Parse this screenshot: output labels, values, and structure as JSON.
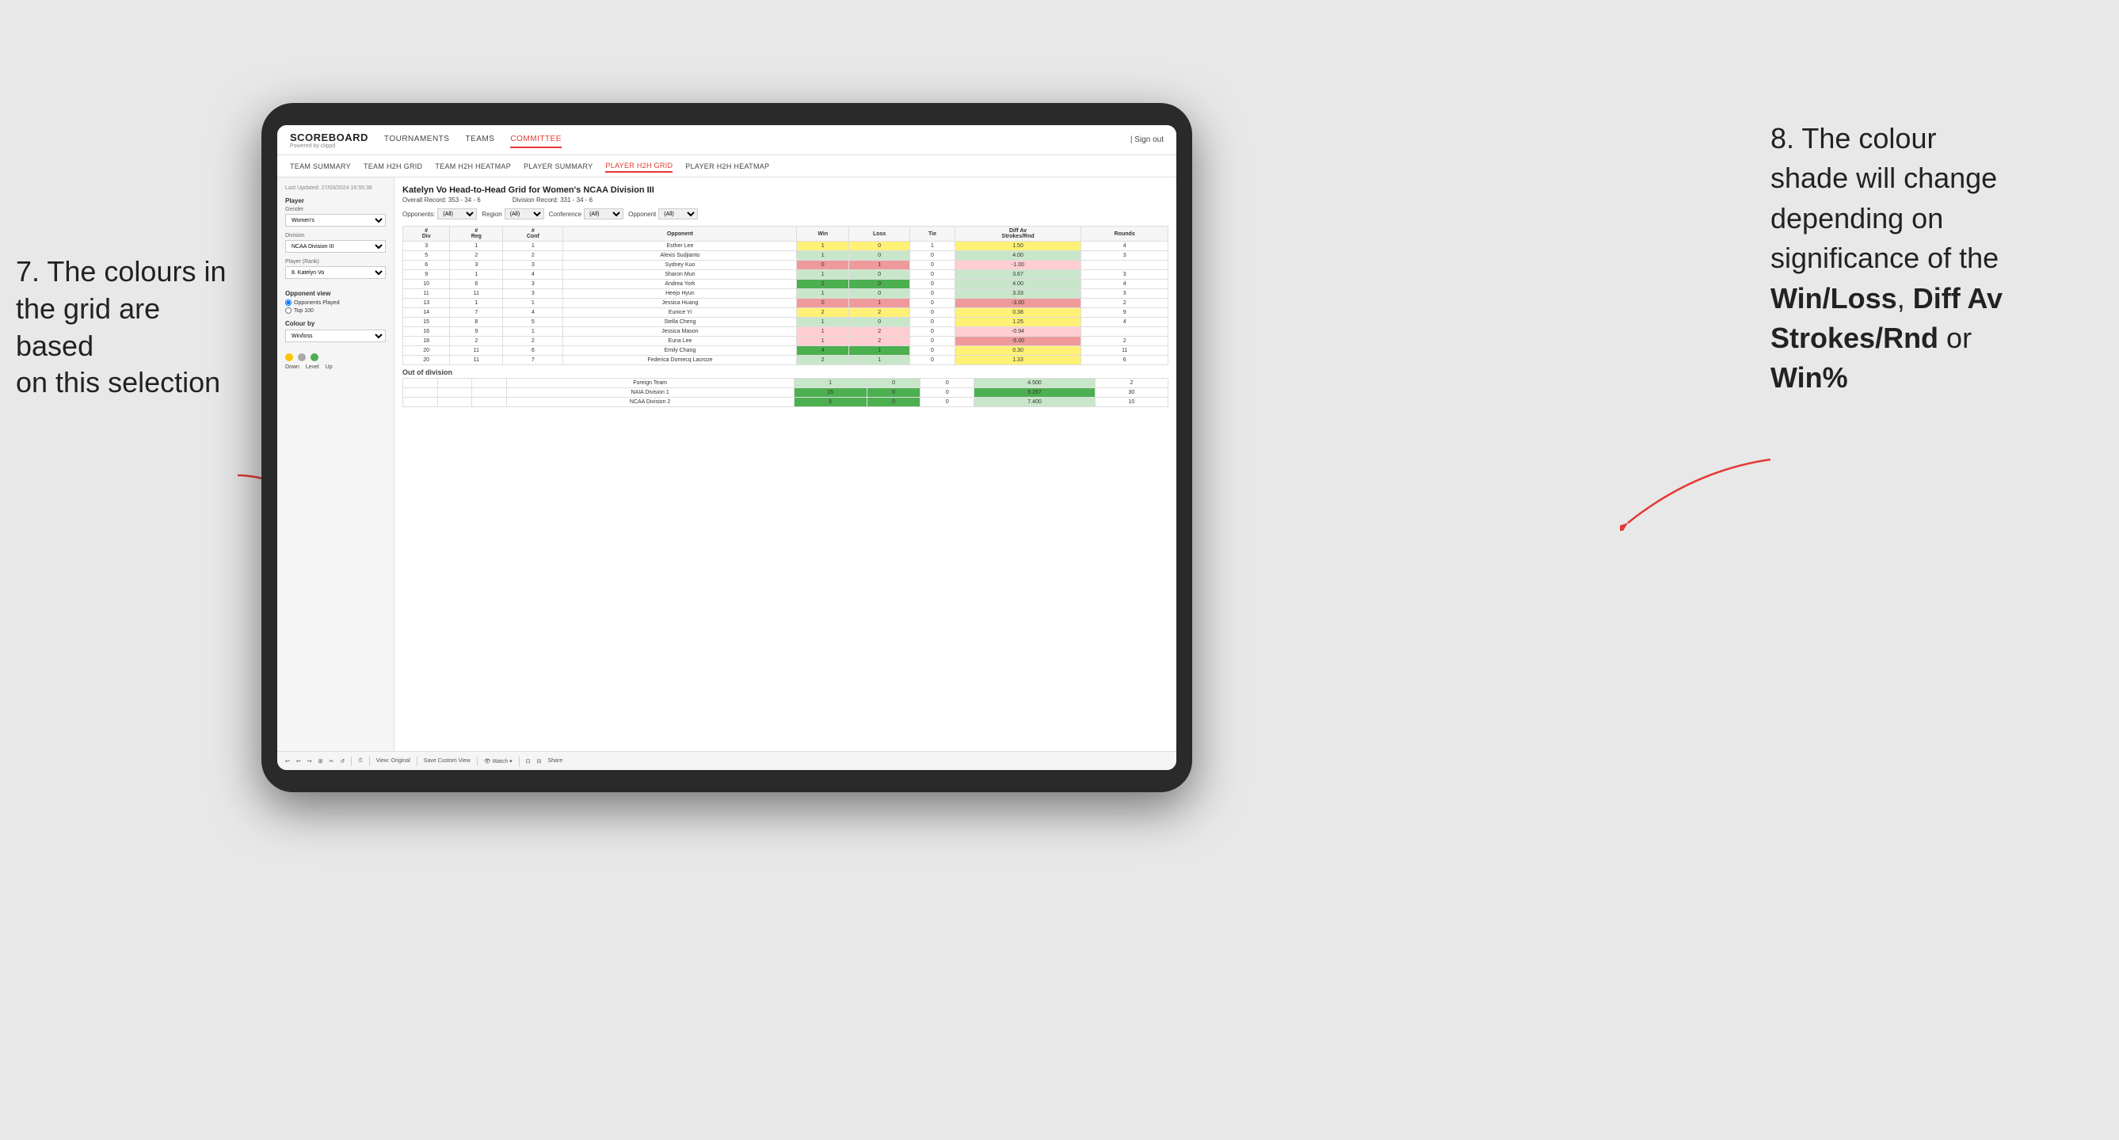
{
  "annotations": {
    "left": {
      "line1": "7. The colours in",
      "line2": "the grid are based",
      "line3": "on this selection"
    },
    "right": {
      "line1": "8. The colour",
      "line2": "shade will change",
      "line3": "depending on",
      "line4": "significance of the",
      "bold1": "Win/Loss",
      "comma": ", ",
      "bold2": "Diff Av",
      "line5": "Strokes/Rnd",
      "line6": " or",
      "bold3": "Win%"
    }
  },
  "nav": {
    "logo": "SCOREBOARD",
    "logo_sub": "Powered by clippd",
    "items": [
      "TOURNAMENTS",
      "TEAMS",
      "COMMITTEE"
    ],
    "active": "COMMITTEE",
    "right_items": [
      "| Sign out"
    ]
  },
  "sub_nav": {
    "items": [
      "TEAM SUMMARY",
      "TEAM H2H GRID",
      "TEAM H2H HEATMAP",
      "PLAYER SUMMARY",
      "PLAYER H2H GRID",
      "PLAYER H2H HEATMAP"
    ],
    "active": "PLAYER H2H GRID"
  },
  "left_panel": {
    "timestamp": "Last Updated: 27/03/2024 16:55:38",
    "player_label": "Player",
    "gender_label": "Gender",
    "gender_value": "Women's",
    "division_label": "Division",
    "division_value": "NCAA Division III",
    "player_rank_label": "Player (Rank)",
    "player_rank_value": "8. Katelyn Vo",
    "opponent_view_label": "Opponent view",
    "radio1": "Opponents Played",
    "radio2": "Top 100",
    "colour_by_label": "Colour by",
    "colour_by_value": "Win/loss",
    "colour_down_label": "Down",
    "colour_level_label": "Level",
    "colour_up_label": "Up"
  },
  "grid": {
    "title": "Katelyn Vo Head-to-Head Grid for Women's NCAA Division III",
    "overall_record_label": "Overall Record:",
    "overall_record": "353 - 34 - 6",
    "division_record_label": "Division Record:",
    "division_record": "331 - 34 - 6",
    "filters": {
      "opponents_label": "Opponents:",
      "opponents_value": "(All)",
      "region_label": "Region",
      "region_value": "(All)",
      "conference_label": "Conference",
      "conference_value": "(All)",
      "opponent_label": "Opponent",
      "opponent_value": "(All)"
    },
    "col_headers": [
      "#\nDiv",
      "#\nReg",
      "#\nConf",
      "Opponent",
      "Win",
      "Loss",
      "Tie",
      "Diff Av\nStrokes/Rnd",
      "Rounds"
    ],
    "rows": [
      {
        "div": "3",
        "reg": "1",
        "conf": "1",
        "name": "Esther Lee",
        "win": "1",
        "loss": "0",
        "tie": "1",
        "diff": "1.50",
        "rounds": "4",
        "win_color": "yellow",
        "diff_color": "yellow"
      },
      {
        "div": "5",
        "reg": "2",
        "conf": "2",
        "name": "Alexis Sudjianto",
        "win": "1",
        "loss": "0",
        "tie": "0",
        "diff": "4.00",
        "rounds": "3",
        "win_color": "green-light",
        "diff_color": "green-light"
      },
      {
        "div": "6",
        "reg": "3",
        "conf": "3",
        "name": "Sydney Kuo",
        "win": "0",
        "loss": "1",
        "tie": "0",
        "diff": "-1.00",
        "rounds": "",
        "win_color": "red",
        "diff_color": "red-light"
      },
      {
        "div": "9",
        "reg": "1",
        "conf": "4",
        "name": "Sharon Mun",
        "win": "1",
        "loss": "0",
        "tie": "0",
        "diff": "3.67",
        "rounds": "3",
        "win_color": "green-light",
        "diff_color": "green-light"
      },
      {
        "div": "10",
        "reg": "6",
        "conf": "3",
        "name": "Andrea York",
        "win": "2",
        "loss": "0",
        "tie": "0",
        "diff": "4.00",
        "rounds": "4",
        "win_color": "green-dark",
        "diff_color": "green-light"
      },
      {
        "div": "11",
        "reg": "11",
        "conf": "3",
        "name": "Heejo Hyun",
        "win": "1",
        "loss": "0",
        "tie": "0",
        "diff": "3.33",
        "rounds": "3",
        "win_color": "green-light",
        "diff_color": "green-light"
      },
      {
        "div": "13",
        "reg": "1",
        "conf": "1",
        "name": "Jessica Huang",
        "win": "0",
        "loss": "1",
        "tie": "0",
        "diff": "-3.00",
        "rounds": "2",
        "win_color": "red",
        "diff_color": "red"
      },
      {
        "div": "14",
        "reg": "7",
        "conf": "4",
        "name": "Eunice Yi",
        "win": "2",
        "loss": "2",
        "tie": "0",
        "diff": "0.38",
        "rounds": "9",
        "win_color": "yellow",
        "diff_color": "yellow"
      },
      {
        "div": "15",
        "reg": "8",
        "conf": "5",
        "name": "Stella Cheng",
        "win": "1",
        "loss": "0",
        "tie": "0",
        "diff": "1.25",
        "rounds": "4",
        "win_color": "green-light",
        "diff_color": "yellow"
      },
      {
        "div": "16",
        "reg": "9",
        "conf": "1",
        "name": "Jessica Mason",
        "win": "1",
        "loss": "2",
        "tie": "0",
        "diff": "-0.94",
        "rounds": "",
        "win_color": "red-light",
        "diff_color": "red-light"
      },
      {
        "div": "18",
        "reg": "2",
        "conf": "2",
        "name": "Euna Lee",
        "win": "1",
        "loss": "2",
        "tie": "0",
        "diff": "-5.00",
        "rounds": "2",
        "win_color": "red-light",
        "diff_color": "red"
      },
      {
        "div": "20",
        "reg": "11",
        "conf": "6",
        "name": "Emily Chang",
        "win": "4",
        "loss": "1",
        "tie": "0",
        "diff": "0.30",
        "rounds": "11",
        "win_color": "green-dark",
        "diff_color": "yellow"
      },
      {
        "div": "20",
        "reg": "11",
        "conf": "7",
        "name": "Federica Domecq Lacroze",
        "win": "2",
        "loss": "1",
        "tie": "0",
        "diff": "1.33",
        "rounds": "6",
        "win_color": "green-light",
        "diff_color": "yellow"
      }
    ],
    "out_of_division_label": "Out of division",
    "out_rows": [
      {
        "name": "Foreign Team",
        "win": "1",
        "loss": "0",
        "tie": "0",
        "diff": "4.500",
        "rounds": "2",
        "win_color": "green-light",
        "diff_color": "green-light"
      },
      {
        "name": "NAIA Division 1",
        "win": "15",
        "loss": "0",
        "tie": "0",
        "diff": "9.267",
        "rounds": "30",
        "win_color": "green-dark",
        "diff_color": "green-dark"
      },
      {
        "name": "NCAA Division 2",
        "win": "5",
        "loss": "0",
        "tie": "0",
        "diff": "7.400",
        "rounds": "10",
        "win_color": "green-dark",
        "diff_color": "green-light"
      }
    ]
  },
  "toolbar": {
    "items": [
      "↩",
      "↩",
      "↪",
      "⊞",
      "✂",
      "↺",
      "·",
      "⏱",
      "|",
      "View: Original",
      "|",
      "Save Custom View",
      "|",
      "👁 Watch ▾",
      "|",
      "⊡",
      "⊟",
      "Share"
    ]
  }
}
